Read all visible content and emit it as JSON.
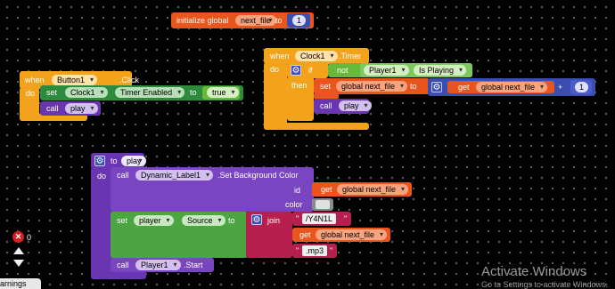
{
  "init_block": {
    "label": "initialize global",
    "var_name": "next_file",
    "to": "to",
    "value": "1"
  },
  "button_event": {
    "when": "when",
    "component": "Button1",
    "event": ".Click",
    "do": "do",
    "set": "set",
    "set_component": "Clock1",
    "property": "Timer Enabled",
    "to": "to",
    "value": "true",
    "call": "call",
    "call_proc": "play"
  },
  "clock_event": {
    "when": "when",
    "component": "Clock1",
    "event": ".Timer",
    "do": "do",
    "if": "if",
    "not": "not",
    "player": "Player1",
    "prop": "Is Playing",
    "then": "then",
    "set": "set",
    "set_var": "global next_file",
    "to": "to",
    "get": "get",
    "get_var": "global next_file",
    "plus": "+",
    "add_value": "1",
    "call": "call",
    "call_proc": "play"
  },
  "play_proc": {
    "to": "to",
    "name": "play",
    "do": "do",
    "call": "call",
    "label_comp": "Dynamic_Label1",
    "method": ".Set Background Color",
    "id": "id",
    "get": "get",
    "get_var": "global next_file",
    "color": "color",
    "set": "set",
    "set_comp": "player",
    "source": "Source",
    "to2": "to",
    "join": "join",
    "str1": "/Y4N1L",
    "get2": "get",
    "get_var2": "global next_file",
    "str2": ".mp3",
    "call2": "call",
    "player_comp": "Player1",
    "start": ".Start"
  },
  "warnings": {
    "count": "0",
    "label": "arnings"
  },
  "watermark": {
    "line1": "Activate Windows",
    "line2": "Go to Settings to activate Windows."
  },
  "colors": {
    "variable": "#e8561e",
    "event": "#f2a31b",
    "procedure": "#6a35b0",
    "text": "#b5204f",
    "logic": "#67b83b",
    "component": "#2e8b3d",
    "math": "#3b4db0"
  }
}
